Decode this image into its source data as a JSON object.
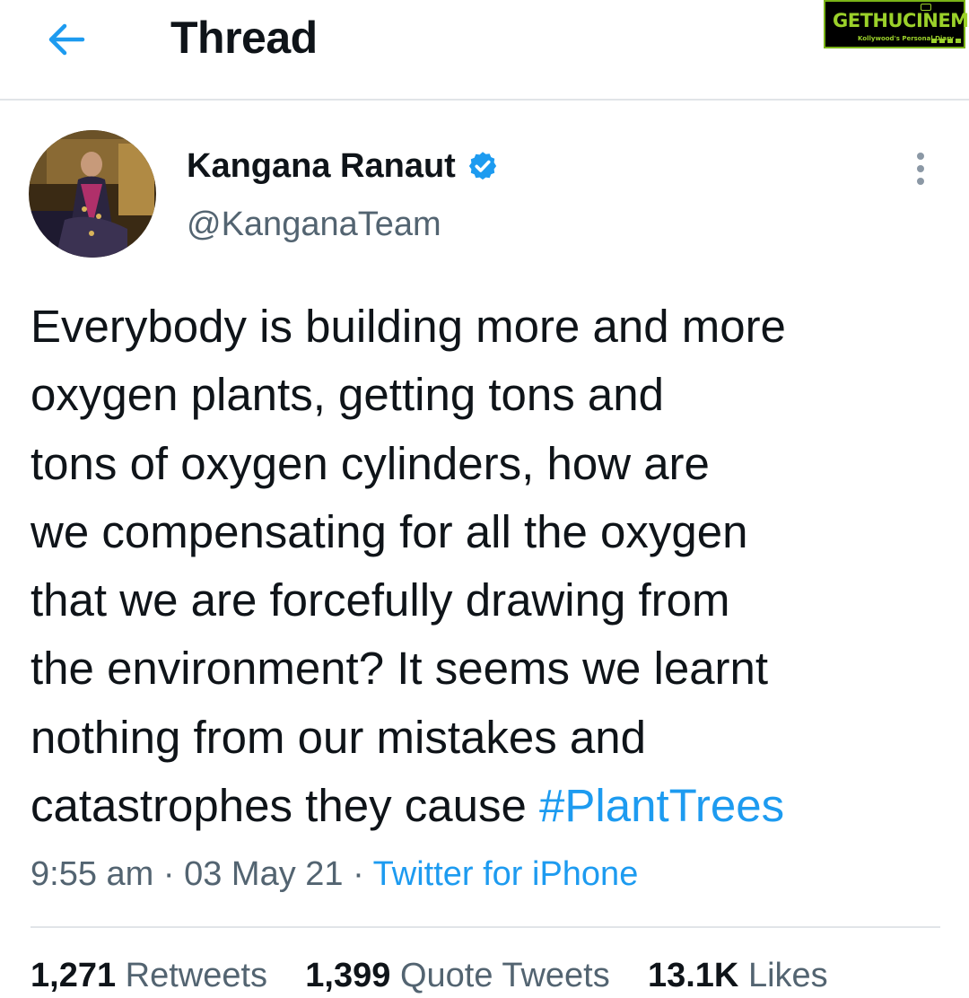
{
  "header": {
    "back_icon": "arrow-left-icon",
    "title": "Thread"
  },
  "watermark": {
    "brand": "GETHUCINEMA",
    "tagline": "Kollywood's Personal Diary"
  },
  "tweet": {
    "author_name": "Kangana Ranaut",
    "verified_icon": "verified-badge-icon",
    "handle": "@KanganaTeam",
    "more_icon": "more-vertical-icon",
    "text_lines": [
      "Everybody is building more and more",
      "oxygen plants, getting tons and",
      "tons of oxygen cylinders, how are",
      "we compensating for all the oxygen",
      "that we are forcefully drawing from",
      "the environment? It seems we learnt",
      "nothing from our mistakes and",
      "catastrophes they cause "
    ],
    "hashtag": "#PlantTrees",
    "time": "9:55 am",
    "date": "03 May 21",
    "separator": " · ",
    "source": "Twitter for iPhone"
  },
  "stats": {
    "retweets_count": "1,271",
    "retweets_label": "Retweets",
    "quotes_count": "1,399",
    "quotes_label": "Quote Tweets",
    "likes_count": "13.1K",
    "likes_label": "Likes"
  },
  "colors": {
    "accent": "#1d9bf0",
    "text_primary": "#0f1419",
    "text_secondary": "#536471",
    "divider": "#e1e4e8"
  }
}
